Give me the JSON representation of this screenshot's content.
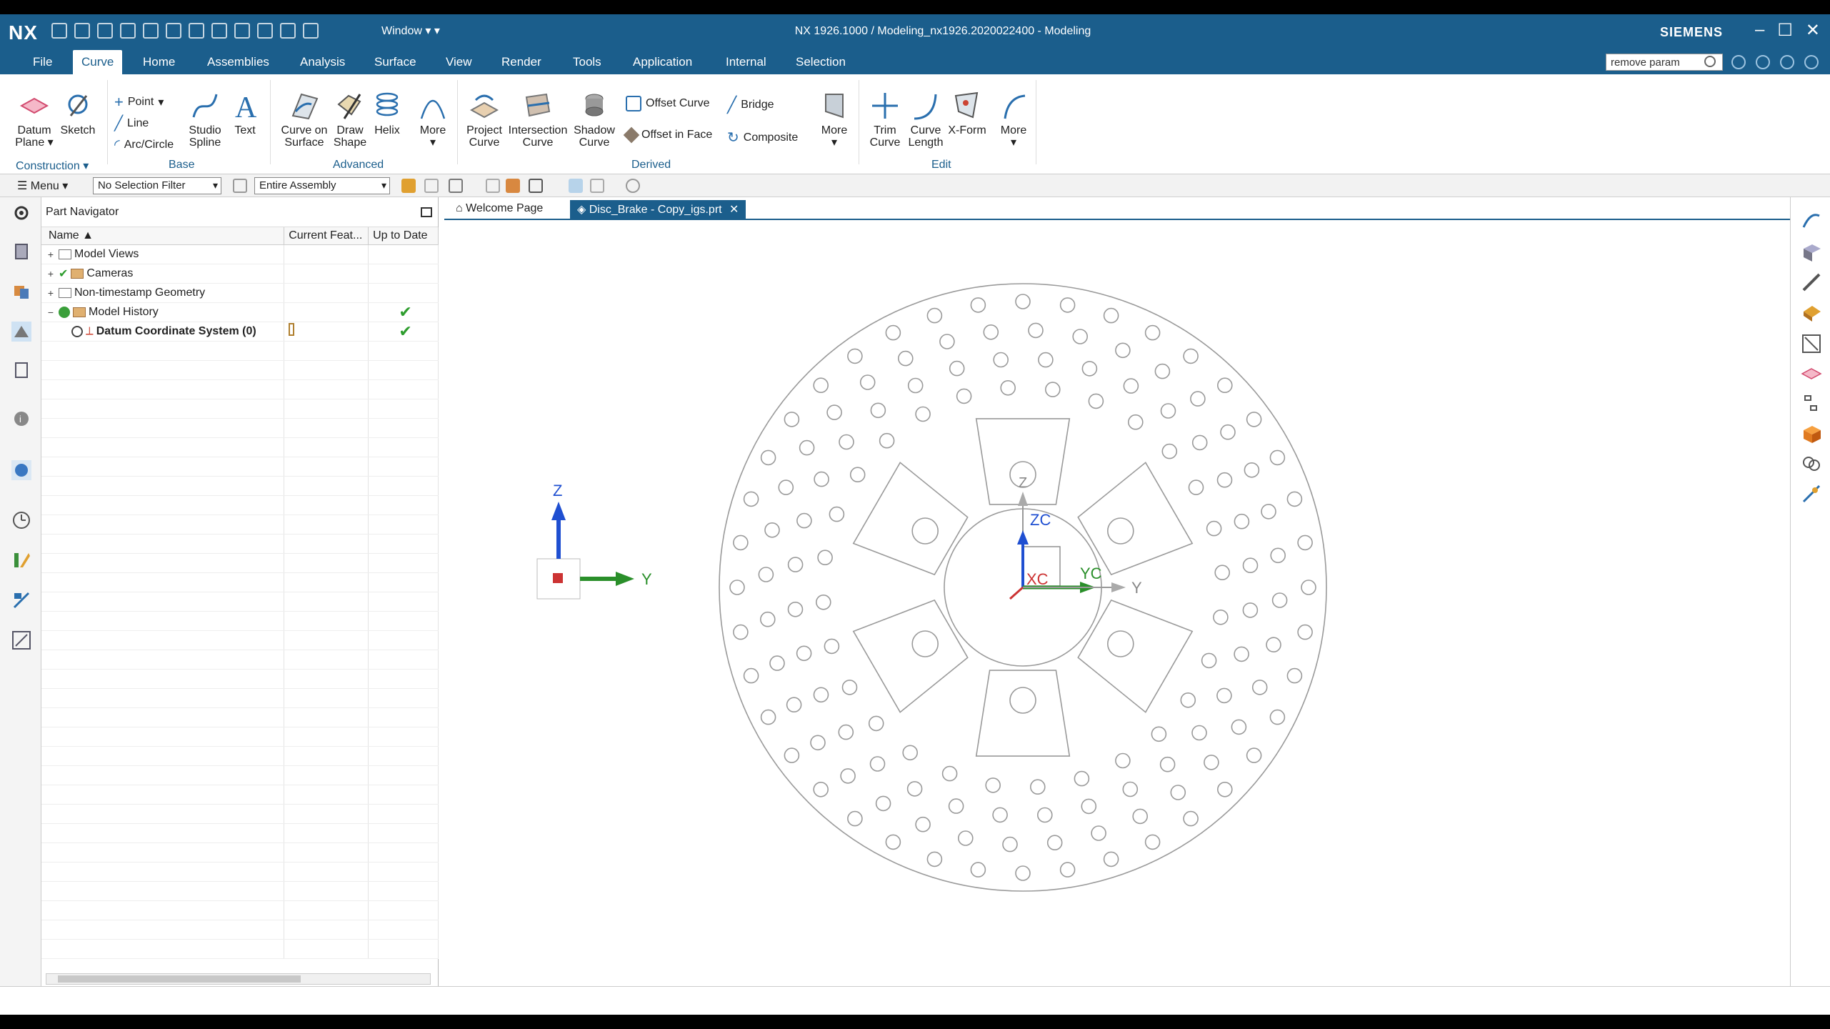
{
  "app": {
    "logo": "NX",
    "window_menu": "Window",
    "title": "NX 1926.1000 / Modeling_nx1926.2020022400 - Modeling",
    "brand": "SIEMENS"
  },
  "menubar": {
    "tabs": [
      "File",
      "Curve",
      "Home",
      "Assemblies",
      "Analysis",
      "Surface",
      "View",
      "Render",
      "Tools",
      "Application",
      "Internal",
      "Selection"
    ],
    "active": "Curve",
    "search_value": "remove param"
  },
  "ribbon": {
    "construction": {
      "label": "Construction",
      "datum_plane": "Datum Plane",
      "sketch": "Sketch"
    },
    "base": {
      "label": "Base",
      "point": "Point",
      "line": "Line",
      "arc_circle": "Arc/Circle",
      "studio_spline": "Studio Spline",
      "text": "Text"
    },
    "advanced": {
      "label": "Advanced",
      "curve_on_surface": "Curve on Surface",
      "draw_shape": "Draw Shape",
      "helix": "Helix",
      "more": "More"
    },
    "derived": {
      "label": "Derived",
      "project_curve": "Project Curve",
      "intersection_curve": "Intersection Curve",
      "shadow_curve": "Shadow Curve",
      "offset_curve": "Offset Curve",
      "offset_in_face": "Offset in Face",
      "bridge": "Bridge",
      "composite": "Composite",
      "more": "More"
    },
    "edit": {
      "label": "Edit",
      "trim_curve": "Trim Curve",
      "curve_length": "Curve Length",
      "xform": "X-Form",
      "more": "More"
    }
  },
  "selbar": {
    "menu": "Menu",
    "filter": "No Selection Filter",
    "scope": "Entire Assembly"
  },
  "part_navigator": {
    "title": "Part Navigator",
    "columns": [
      "Name",
      "Current Feat...",
      "Up to Date"
    ],
    "rows": [
      {
        "name": "Model Views",
        "expander": "+",
        "uptodate": ""
      },
      {
        "name": "Cameras",
        "expander": "+",
        "uptodate": ""
      },
      {
        "name": "Non-timestamp Geometry",
        "expander": "+",
        "uptodate": ""
      },
      {
        "name": "Model History",
        "expander": "−",
        "uptodate": "✔"
      },
      {
        "name": "Datum Coordinate System (0)",
        "expander": "",
        "uptodate": "✔"
      }
    ]
  },
  "tabs": {
    "welcome": "Welcome Page",
    "active": "Disc_Brake - Copy_igs.prt"
  },
  "viewport": {
    "wcs_labels": {
      "z": "Z",
      "zc": "ZC",
      "xc": "XC",
      "yc": "YC",
      "y": "Y"
    },
    "triad_labels": {
      "z": "Z",
      "y": "Y"
    }
  },
  "colors": {
    "titlebar": "#1b5e8c",
    "accent": "#1b5e8c",
    "ok_green": "#2e9d2e"
  }
}
